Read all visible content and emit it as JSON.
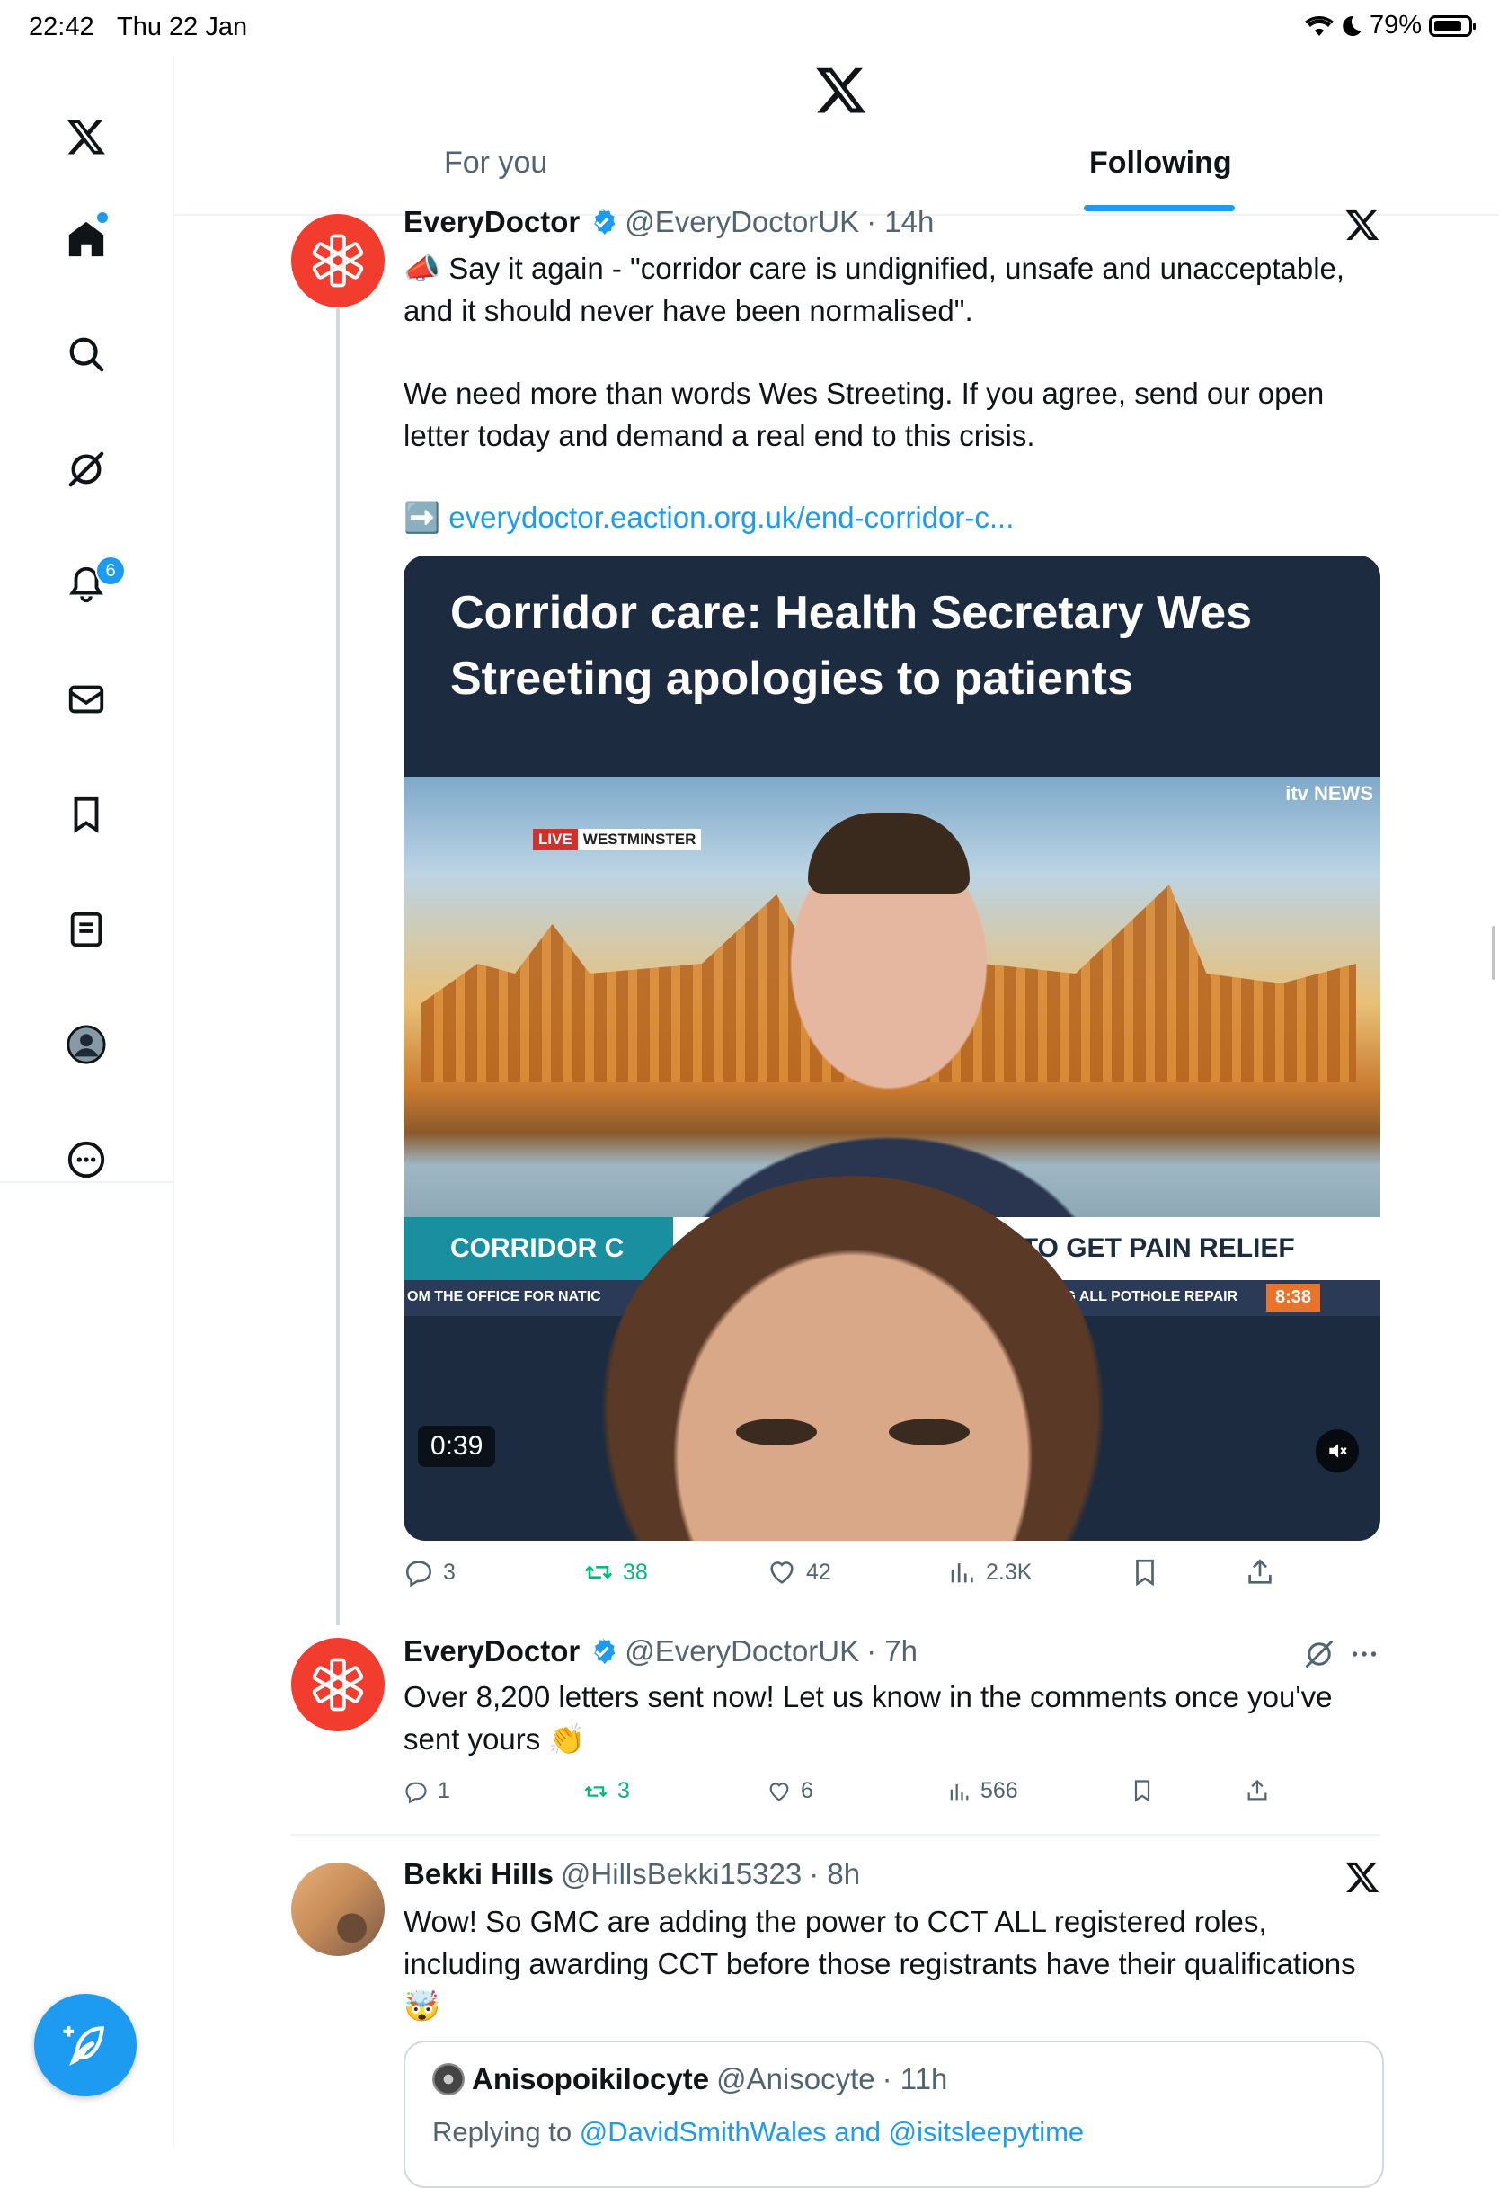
{
  "status_bar": {
    "time": "22:42",
    "date": "Thu 22 Jan",
    "battery": "79%"
  },
  "header": {
    "tabs": [
      {
        "label": "For you",
        "active": false
      },
      {
        "label": "Following",
        "active": true
      }
    ]
  },
  "sidebar": {
    "items": [
      "x-logo",
      "home",
      "search",
      "grok",
      "notifications",
      "messages",
      "bookmarks",
      "lists",
      "profile",
      "more"
    ],
    "notifications_badge": "6"
  },
  "colors": {
    "accent": "#1d9bf0",
    "retweet": "#00ba7c",
    "everydoctor_red": "#f23c2e"
  },
  "tweets": [
    {
      "name": "EveryDoctor",
      "handle": "@EveryDoctorUK",
      "time": "· 14h",
      "text_line1": "📣 Say it again - \"corridor care is undignified, unsafe and unacceptable, and it should never have been normalised\".",
      "text_line2": "We need more than words Wes Streeting. If you agree, send our open letter today and demand a real end to this crisis.",
      "link_prefix": "➡️",
      "link": "everydoctor.eaction.org.uk/end-corridor-c...",
      "media": {
        "headline": "Corridor care: Health Secretary Wes Streeting apologies to patients",
        "live": "LIVE",
        "location": "WESTMINSTER",
        "channel": "itv NEWS",
        "lower_third_left": "CORRIDOR C",
        "lower_third_right": "CRAWL TO GET PAIN RELIEF",
        "ticker_left": "OM THE OFFICE FOR NATIC",
        "ticker_right": "RS ARE DEMANDING ALL POTHOLE REPAIR",
        "clock": "8:38",
        "duration": "0:39"
      },
      "stats": {
        "replies": "3",
        "reposts": "38",
        "likes": "42",
        "views": "2.3K"
      }
    },
    {
      "name": "EveryDoctor",
      "handle": "@EveryDoctorUK",
      "time": "· 7h",
      "text": "Over 8,200 letters sent now! Let us know in the comments once you've sent yours 👏",
      "stats": {
        "replies": "1",
        "reposts": "3",
        "likes": "6",
        "views": "566"
      }
    },
    {
      "name": "Bekki Hills",
      "handle": "@HillsBekki15323",
      "time": "· 8h",
      "text": "Wow! So GMC are adding the power to CCT ALL registered roles, including awarding CCT before those registrants have their qualifications 🤯",
      "quote": {
        "name": "Anisopoikilocyte",
        "handle": "@Anisocyte",
        "time": "· 11h",
        "reply_prefix": "Replying to",
        "reply_to": "@DavidSmithWales and @isitsleepytime"
      }
    }
  ]
}
